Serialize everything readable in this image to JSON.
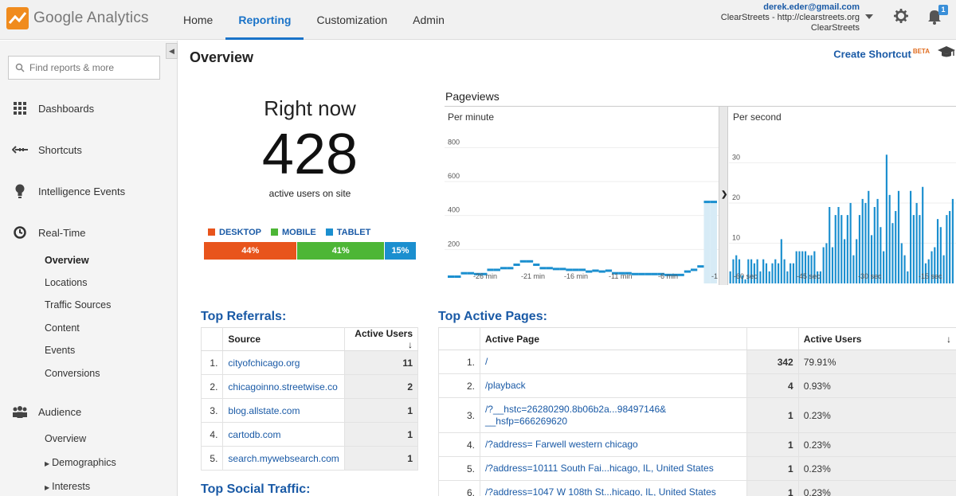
{
  "app": {
    "name": "Google Analytics"
  },
  "topnav": [
    "Home",
    "Reporting",
    "Customization",
    "Admin"
  ],
  "account": {
    "email": "derek.eder@gmail.com",
    "property": "ClearStreets - http://clearstreets.org",
    "view": "ClearStreets"
  },
  "notifications": {
    "badge": "1"
  },
  "search": {
    "placeholder": "Find reports & more"
  },
  "sidebar": {
    "dashboards": "Dashboards",
    "shortcuts": "Shortcuts",
    "intelligence": "Intelligence Events",
    "realtime": "Real-Time",
    "realtime_items": [
      "Overview",
      "Locations",
      "Traffic Sources",
      "Content",
      "Events",
      "Conversions"
    ],
    "audience": "Audience",
    "audience_items": [
      "Overview",
      "Demographics",
      "Interests"
    ]
  },
  "page": {
    "title": "Overview",
    "shortcut": "Create Shortcut",
    "shortcut_badge": "BETA"
  },
  "rightnow": {
    "title": "Right now",
    "count": "428",
    "subtitle": "active users on site",
    "devices": [
      {
        "label": "DESKTOP",
        "percent": 44,
        "text": "44%",
        "color": "#e8541c"
      },
      {
        "label": "MOBILE",
        "percent": 41,
        "text": "41%",
        "color": "#4db636"
      },
      {
        "label": "TABLET",
        "percent": 15,
        "text": "15%",
        "color": "#1b8fcf"
      }
    ]
  },
  "pageviews": {
    "title": "Pageviews",
    "per_minute": "Per minute",
    "per_second": "Per second"
  },
  "chart_data": [
    {
      "type": "bar",
      "title": "Per minute",
      "yticks": [
        200,
        400,
        600,
        800
      ],
      "xticks": [
        "-26 min",
        "-21 min",
        "-16 min",
        "-11 min",
        "-6 min",
        "-1"
      ],
      "ylim": [
        0,
        900
      ],
      "values": [
        40,
        40,
        60,
        60,
        55,
        55,
        80,
        80,
        90,
        90,
        110,
        130,
        130,
        110,
        90,
        90,
        85,
        85,
        80,
        80,
        80,
        70,
        75,
        70,
        75,
        60,
        60,
        60,
        55,
        55,
        55,
        55,
        55,
        50,
        50,
        50,
        70,
        80,
        100,
        480,
        480
      ],
      "color": "#1b8fcf"
    },
    {
      "type": "bar",
      "title": "Per second",
      "yticks": [
        10,
        20,
        30
      ],
      "xticks": [
        "-60 sec",
        "-45 sec",
        "-30 sec",
        "-15 sec"
      ],
      "ylim": [
        0,
        38
      ],
      "values": [
        3,
        6,
        7,
        6,
        2,
        1,
        6,
        6,
        5,
        6,
        3,
        6,
        5,
        3,
        5,
        6,
        5,
        11,
        6,
        3,
        5,
        5,
        8,
        8,
        8,
        8,
        7,
        7,
        8,
        3,
        3,
        9,
        10,
        19,
        9,
        17,
        19,
        17,
        11,
        17,
        20,
        7,
        11,
        17,
        21,
        20,
        23,
        12,
        19,
        21,
        14,
        8,
        32,
        22,
        15,
        18,
        23,
        10,
        7,
        3,
        23,
        17,
        20,
        17,
        24,
        5,
        6,
        8,
        9,
        16,
        14,
        7,
        17,
        18,
        21
      ],
      "color": "#1b8fcf"
    }
  ],
  "referrals": {
    "title": "Top Referrals:",
    "headers": [
      "Source",
      "Active Users"
    ],
    "rows": [
      {
        "idx": "1.",
        "source": "cityofchicago.org",
        "users": "11"
      },
      {
        "idx": "2.",
        "source": "chicagoinno.streetwise.co",
        "users": "2"
      },
      {
        "idx": "3.",
        "source": "blog.allstate.com",
        "users": "1"
      },
      {
        "idx": "4.",
        "source": "cartodb.com",
        "users": "1"
      },
      {
        "idx": "5.",
        "source": "search.mywebsearch.com",
        "users": "1"
      }
    ]
  },
  "pages": {
    "title": "Top Active Pages:",
    "headers": [
      "Active Page",
      "Active Users"
    ],
    "rows": [
      {
        "idx": "1.",
        "page": "/",
        "users": "342",
        "pct": "79.91%"
      },
      {
        "idx": "2.",
        "page": "/playback",
        "users": "4",
        "pct": "0.93%"
      },
      {
        "idx": "3.",
        "page": "/?__hstc=26280290.8b06b2a...98497146&",
        "page2": "__hsfp=666269620",
        "users": "1",
        "pct": "0.23%"
      },
      {
        "idx": "4.",
        "page": "/?address= Farwell western chicago",
        "users": "1",
        "pct": "0.23%"
      },
      {
        "idx": "5.",
        "page": "/?address=10111 South Fai...hicago, IL, United States",
        "users": "1",
        "pct": "0.23%"
      },
      {
        "idx": "6.",
        "page": "/?address=1047 W 108th St...hicago, IL, United States",
        "users": "1",
        "pct": "0.23%"
      }
    ]
  },
  "social": {
    "title": "Top Social Traffic:"
  }
}
